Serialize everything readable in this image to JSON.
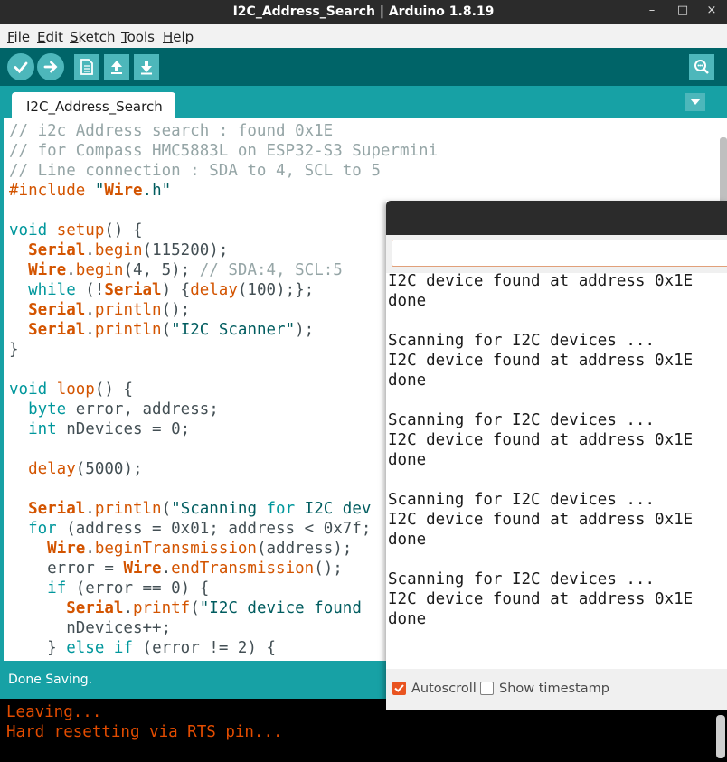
{
  "window": {
    "title": "I2C_Address_Search | Arduino 1.8.19",
    "minimize_symbol": "–",
    "maximize_symbol": "□",
    "close_symbol": "×"
  },
  "menu": [
    {
      "accel": "F",
      "rest": "ile"
    },
    {
      "accel": "E",
      "rest": "dit"
    },
    {
      "accel": "S",
      "rest": "ketch"
    },
    {
      "accel": "T",
      "rest": "ools"
    },
    {
      "accel": "H",
      "rest": "elp"
    }
  ],
  "toolbar": {
    "icons": [
      "verify-icon",
      "upload-icon",
      "new-icon",
      "open-icon",
      "save-icon",
      "serial-monitor-icon"
    ]
  },
  "tabs": [
    {
      "label": "I2C_Address_Search"
    }
  ],
  "editor": {
    "lines": [
      "// i2c Address search : found 0x1E",
      "// for Compass HMC5883L on ESP32-S3 Supermini",
      "// Line connection : SDA to 4, SCL to 5",
      "#include \"Wire.h\"",
      "",
      "void setup() {",
      "  Serial.begin(115200);",
      "  Wire.begin(4, 5); // SDA:4, SCL:5",
      "  while (!Serial) {delay(100);};",
      "  Serial.println();",
      "  Serial.println(\"I2C Scanner\");",
      "}",
      "",
      "void loop() {",
      "  byte error, address;",
      "  int nDevices = 0;",
      "",
      "  delay(5000);",
      "",
      "  Serial.println(\"Scanning for I2C dev",
      "  for (address = 0x01; address < 0x7f;",
      "    Wire.beginTransmission(address);",
      "    error = Wire.endTransmission();",
      "    if (error == 0) {",
      "      Serial.printf(\"I2C device found",
      "      nDevices++;",
      "    } else if (error != 2) {"
    ]
  },
  "status": {
    "message": "Done Saving."
  },
  "console": {
    "lines": [
      "Leaving...",
      "Hard resetting via RTS pin..."
    ]
  },
  "serial_monitor": {
    "input_value": "",
    "output": "I2C device found at address 0x1E\ndone\n\nScanning for I2C devices ...\nI2C device found at address 0x1E\ndone\n\nScanning for I2C devices ...\nI2C device found at address 0x1E\ndone\n\nScanning for I2C devices ...\nI2C device found at address 0x1E\ndone\n\nScanning for I2C devices ...\nI2C device found at address 0x1E\ndone",
    "autoscroll_label": "Autoscroll",
    "autoscroll_checked": true,
    "timestamp_label": "Show timestamp",
    "timestamp_checked": false
  },
  "colors": {
    "toolbar": "#006468",
    "tab_bar": "#17a1a5",
    "button": "#4db7bb",
    "console_text": "#e34c00",
    "checkbox_on": "#e95420"
  }
}
